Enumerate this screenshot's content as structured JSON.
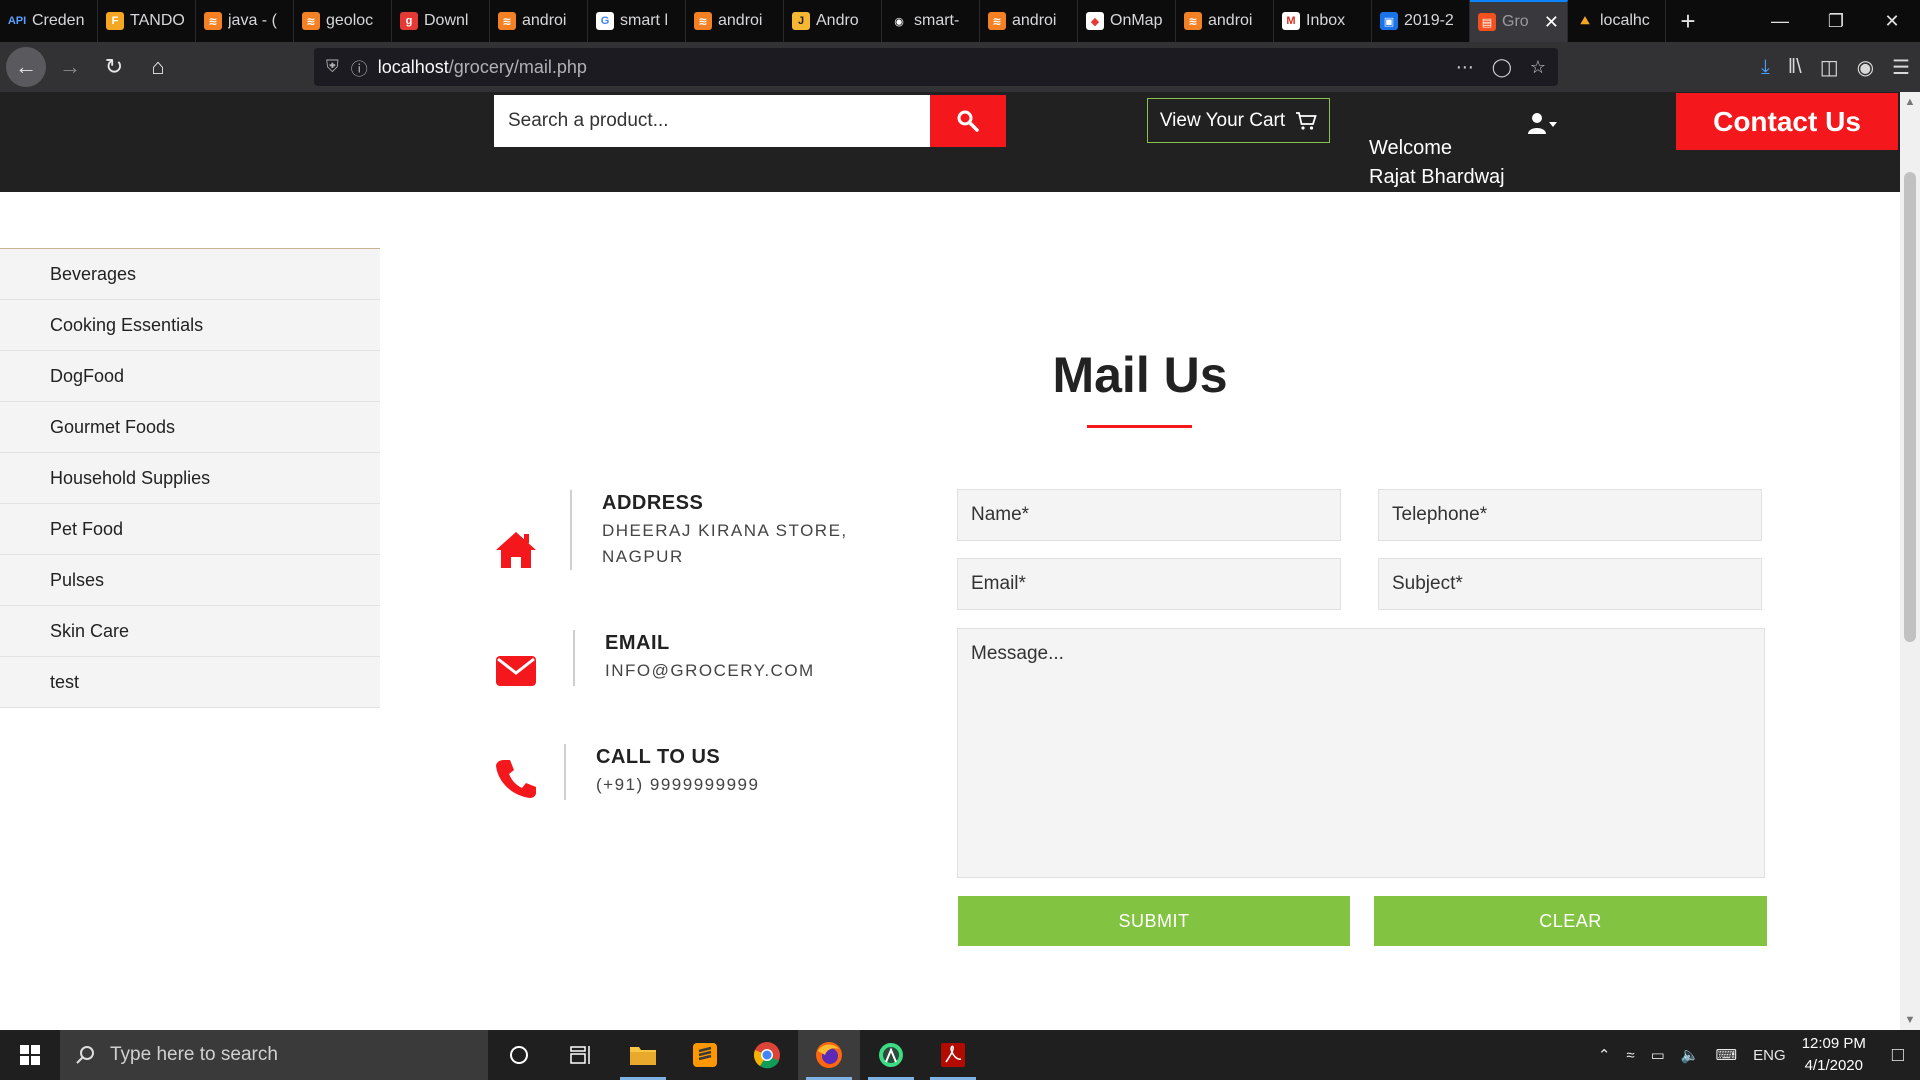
{
  "browser": {
    "tabs": [
      {
        "label": "Creden",
        "fav": "API",
        "color": "#0c0c0d",
        "fg": "#5aa0ff"
      },
      {
        "label": "TANDO",
        "fav": "F",
        "color": "#f5a623",
        "fg": "#fff"
      },
      {
        "label": "java - (",
        "fav": "≋",
        "color": "#f48024",
        "fg": "#fff"
      },
      {
        "label": "geoloc",
        "fav": "≋",
        "color": "#f48024",
        "fg": "#fff"
      },
      {
        "label": "Downl",
        "fav": "g",
        "color": "#e53935",
        "fg": "#fff"
      },
      {
        "label": "androi",
        "fav": "≋",
        "color": "#f48024",
        "fg": "#fff"
      },
      {
        "label": "smart l",
        "fav": "G",
        "color": "#ffffff",
        "fg": "#4285f4"
      },
      {
        "label": "androi",
        "fav": "≋",
        "color": "#f48024",
        "fg": "#fff"
      },
      {
        "label": "Andro",
        "fav": "J",
        "color": "#f7b733",
        "fg": "#222"
      },
      {
        "label": "smart-",
        "fav": "◉",
        "color": "#0c0c0d",
        "fg": "#fff"
      },
      {
        "label": "androi",
        "fav": "≋",
        "color": "#f48024",
        "fg": "#fff"
      },
      {
        "label": "OnMap",
        "fav": "◆",
        "color": "#ffffff",
        "fg": "#e53935"
      },
      {
        "label": "androi",
        "fav": "≋",
        "color": "#f48024",
        "fg": "#fff"
      },
      {
        "label": "Inbox",
        "fav": "M",
        "color": "#ffffff",
        "fg": "#d93025"
      },
      {
        "label": "2019-2",
        "fav": "▣",
        "color": "#1a73e8",
        "fg": "#fff"
      },
      {
        "label": "Gro",
        "fav": "▤",
        "color": "#f4511e",
        "fg": "#fff",
        "active": true
      },
      {
        "label": "localhc",
        "fav": "⛰",
        "color": "#0c0c0d",
        "fg": "#f5a623"
      }
    ],
    "url_host": "localhost",
    "url_path": "/grocery/mail.php"
  },
  "header": {
    "search_placeholder": "Search a product...",
    "cart_label": "View Your Cart",
    "welcome_line1": "Welcome",
    "welcome_line2": "Rajat Bhardwaj",
    "contact_label": "Contact Us"
  },
  "sidebar": {
    "items": [
      {
        "label": "Beverages"
      },
      {
        "label": "Cooking Essentials"
      },
      {
        "label": "DogFood"
      },
      {
        "label": "Gourmet Foods"
      },
      {
        "label": "Household Supplies"
      },
      {
        "label": "Pet Food"
      },
      {
        "label": "Pulses"
      },
      {
        "label": "Skin Care"
      },
      {
        "label": "test"
      }
    ]
  },
  "main": {
    "title": "Mail Us",
    "address": {
      "title": "ADDRESS",
      "line1": "DHEERAJ KIRANA STORE,",
      "line2": "NAGPUR"
    },
    "email": {
      "title": "EMAIL",
      "value": "INFO@GROCERY.COM"
    },
    "phone": {
      "title": "CALL TO US",
      "value": "(+91) 9999999999"
    },
    "form": {
      "name_placeholder": "Name*",
      "telephone_placeholder": "Telephone*",
      "email_placeholder": "Email*",
      "subject_placeholder": "Subject*",
      "message_placeholder": "Message...",
      "submit_label": "SUBMIT",
      "clear_label": "CLEAR"
    }
  },
  "taskbar": {
    "search_placeholder": "Type here to search",
    "language": "ENG",
    "time": "12:09 PM",
    "date": "4/1/2020"
  },
  "colors": {
    "accent_red": "#f4171c",
    "button_green": "#82c341",
    "header_dark": "#212121"
  }
}
